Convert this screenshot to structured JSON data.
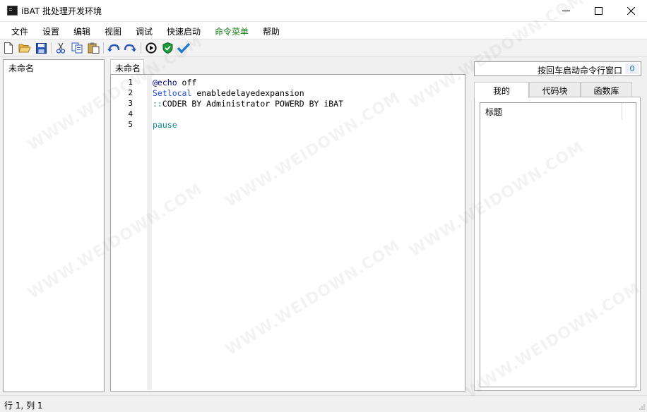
{
  "window": {
    "title": "iBAT 批处理开发环境",
    "controls": [
      "minimize-icon",
      "maximize-icon",
      "close-icon"
    ]
  },
  "menu": {
    "items": [
      "文件",
      "设置",
      "编辑",
      "视图",
      "调试",
      "快速启动",
      "命令菜单",
      "帮助"
    ],
    "highlight_color": "#1a7f1a"
  },
  "toolbar": {
    "icons": [
      "new-file-icon",
      "open-folder-icon",
      "save-icon",
      "cut-icon",
      "copy-icon",
      "paste-icon",
      "undo-icon",
      "redo-icon",
      "run-icon",
      "shield-check-icon",
      "checkmark-icon"
    ]
  },
  "left_panel": {
    "items": [
      "未命名"
    ]
  },
  "editor": {
    "tab_label": "未命名",
    "lines": [
      {
        "num": "1",
        "parts": [
          {
            "text": "@echo",
            "cls": "kw-echo"
          },
          {
            "text": " off",
            "cls": ""
          }
        ]
      },
      {
        "num": "2",
        "parts": [
          {
            "text": "Setlocal",
            "cls": "kw-set"
          },
          {
            "text": " enabledelayedexpansion",
            "cls": ""
          }
        ]
      },
      {
        "num": "3",
        "parts": [
          {
            "text": "::",
            "cls": "kw-comment"
          },
          {
            "text": "CODER BY Administrator POWERD BY iBAT",
            "cls": ""
          }
        ]
      },
      {
        "num": "4",
        "parts": []
      },
      {
        "num": "5",
        "parts": [
          {
            "text": "pause",
            "cls": "kw-pause"
          }
        ]
      }
    ]
  },
  "command_box": {
    "label": "按回车启动命令行窗口",
    "count": "0"
  },
  "right_tabs": [
    "我的",
    "代码块",
    "函数库"
  ],
  "right_list": {
    "column_header": "标题"
  },
  "status": {
    "text": "行 1, 列 1"
  },
  "watermark_text": "WWW.WEIDOWN.COM"
}
